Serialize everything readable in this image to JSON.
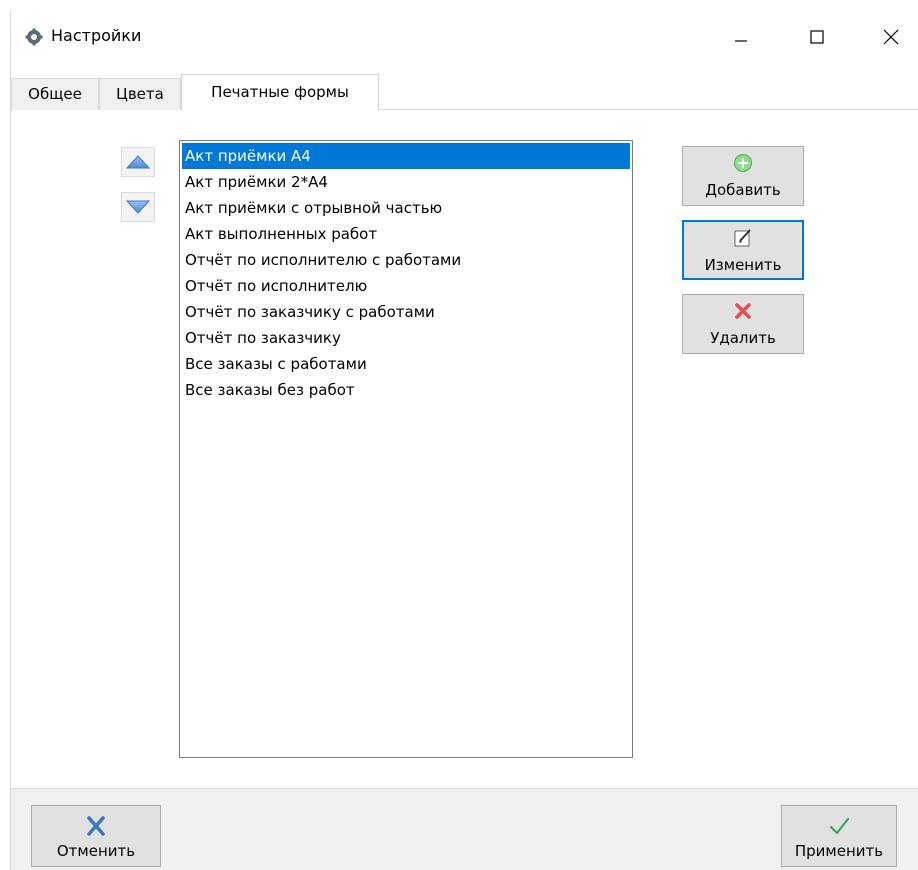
{
  "window": {
    "title": "Настройки",
    "icon": "gear-icon"
  },
  "title_controls": {
    "minimize_icon": "minimize-icon",
    "maximize_icon": "maximize-icon",
    "close_icon": "close-icon"
  },
  "tabs": [
    {
      "label": "Общее",
      "active": false
    },
    {
      "label": "Цвета",
      "active": false
    },
    {
      "label": "Печатные формы",
      "active": true
    }
  ],
  "print_forms": {
    "items": [
      {
        "label": "Акт приёмки А4",
        "selected": true
      },
      {
        "label": "Акт приёмки 2*А4",
        "selected": false
      },
      {
        "label": "Акт приёмки с отрывной частью",
        "selected": false
      },
      {
        "label": "Акт выполненных работ",
        "selected": false
      },
      {
        "label": "Отчёт по исполнителю с работами",
        "selected": false
      },
      {
        "label": "Отчёт по исполнителю",
        "selected": false
      },
      {
        "label": "Отчёт по заказчику с работами",
        "selected": false
      },
      {
        "label": "Отчёт по заказчику",
        "selected": false
      },
      {
        "label": "Все заказы с работами",
        "selected": false
      },
      {
        "label": "Все заказы без работ",
        "selected": false
      }
    ]
  },
  "actions": {
    "add_label": "Добавить",
    "edit_label": "Изменить",
    "delete_label": "Удалить"
  },
  "footer": {
    "cancel_label": "Отменить",
    "apply_label": "Применить"
  },
  "colors": {
    "selection": "#0078d7",
    "add_icon": "#5cb85c",
    "delete_icon": "#e05050",
    "cancel_icon": "#3a76c4",
    "apply_icon": "#3aa65a"
  }
}
